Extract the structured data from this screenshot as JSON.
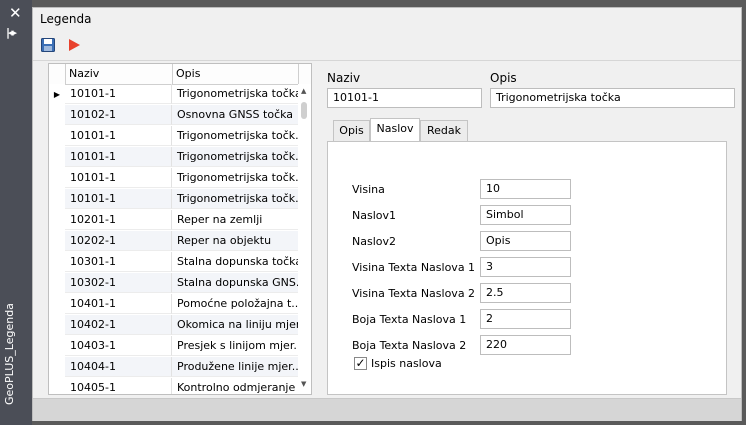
{
  "sidebar": {
    "title": "GeoPLUS_Legenda"
  },
  "window": {
    "title": "Legenda"
  },
  "grid": {
    "columns": [
      "Naziv",
      "Opis"
    ],
    "rows": [
      {
        "naziv": "10101-1",
        "opis": "Trigonometrijska točka"
      },
      {
        "naziv": "10102-1",
        "opis": "Osnovna GNSS točka"
      },
      {
        "naziv": "10101-1",
        "opis": "Trigonometrijska točk..."
      },
      {
        "naziv": "10101-1",
        "opis": "Trigonometrijska točk..."
      },
      {
        "naziv": "10101-1",
        "opis": "Trigonometrijska točk..."
      },
      {
        "naziv": "10101-1",
        "opis": "Trigonometrijska točk..."
      },
      {
        "naziv": "10201-1",
        "opis": "Reper na zemlji"
      },
      {
        "naziv": "10202-1",
        "opis": "Reper na objektu"
      },
      {
        "naziv": "10301-1",
        "opis": "Stalna dopunska točka"
      },
      {
        "naziv": "10302-1",
        "opis": "Stalna dopunska GNS..."
      },
      {
        "naziv": "10401-1",
        "opis": "Pomoćne položajna t..."
      },
      {
        "naziv": "10402-1",
        "opis": "Okomica na liniju mjer..."
      },
      {
        "naziv": "10403-1",
        "opis": "Presjek s linijom mjer..."
      },
      {
        "naziv": "10404-1",
        "opis": "Produžene linije mjer..."
      },
      {
        "naziv": "10405-1",
        "opis": "Kontrolno odmjeranje"
      }
    ]
  },
  "detail": {
    "naziv_label": "Naziv",
    "naziv_value": "10101-1",
    "opis_label": "Opis",
    "opis_value": "Trigonometrijska točka"
  },
  "tabs": [
    "Opis",
    "Naslov",
    "Redak"
  ],
  "active_tab": "Naslov",
  "naslov": {
    "fields": [
      {
        "label": "Visina",
        "value": "10"
      },
      {
        "label": "Naslov1",
        "value": "Simbol"
      },
      {
        "label": "Naslov2",
        "value": "Opis"
      },
      {
        "label": "Visina Texta Naslova 1",
        "value": "3"
      },
      {
        "label": "Visina Texta Naslova 2",
        "value": "2.5"
      },
      {
        "label": "Boja Texta Naslova 1",
        "value": "2"
      },
      {
        "label": "Boja Texta Naslova 2",
        "value": "220"
      }
    ],
    "checkbox_label": "Ispis naslova",
    "checkbox_checked": true
  }
}
